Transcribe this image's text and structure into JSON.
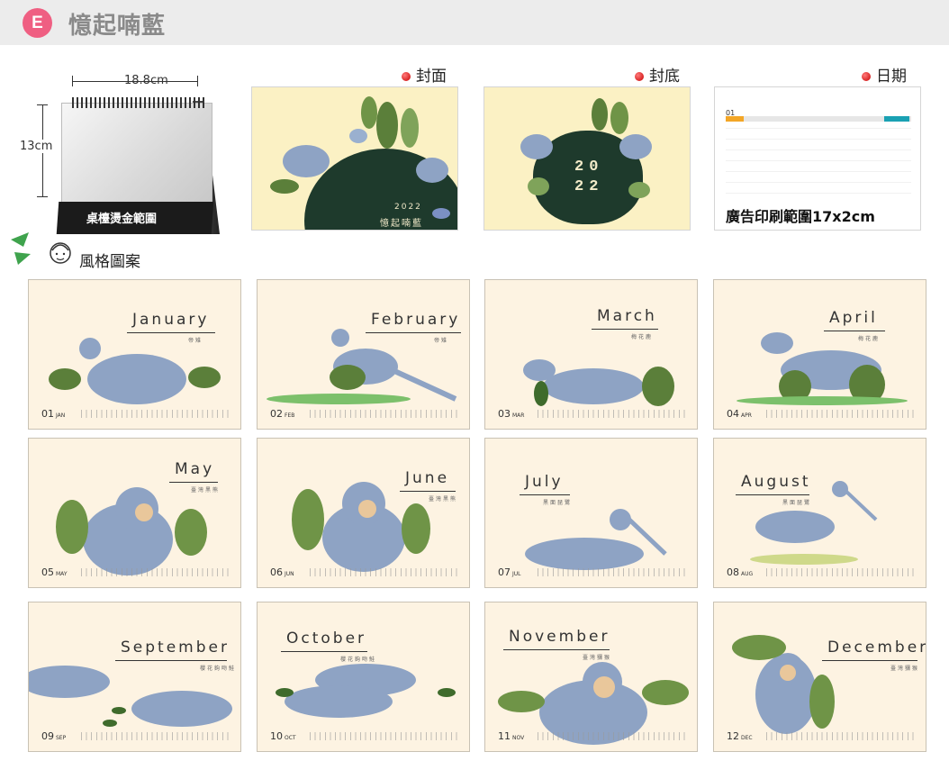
{
  "header": {
    "badge": "E",
    "title": "憶起喃藍"
  },
  "product": {
    "width_label": "18.8cm",
    "height_label": "13cm",
    "base_label": "桌檯燙金範圍"
  },
  "sections": {
    "cover": "封面",
    "back": "封底",
    "date": "日期"
  },
  "cover": {
    "year": "2022",
    "name": "憶起喃藍"
  },
  "back": {
    "year": "20 22"
  },
  "date_panel": {
    "month": "01",
    "ad_text": "廣告印刷範圍17x2cm"
  },
  "style_label": "風格圖案",
  "months": [
    {
      "name": "January",
      "sub": "帝雉",
      "num": "01",
      "abbr": "JAN"
    },
    {
      "name": "February",
      "sub": "帝雉",
      "num": "02",
      "abbr": "FEB"
    },
    {
      "name": "March",
      "sub": "梅花鹿",
      "num": "03",
      "abbr": "MAR"
    },
    {
      "name": "April",
      "sub": "梅花鹿",
      "num": "04",
      "abbr": "APR"
    },
    {
      "name": "May",
      "sub": "臺灣黑熊",
      "num": "05",
      "abbr": "MAY"
    },
    {
      "name": "June",
      "sub": "臺灣黑熊",
      "num": "06",
      "abbr": "JUN"
    },
    {
      "name": "July",
      "sub": "黑面琵鷺",
      "num": "07",
      "abbr": "JUL"
    },
    {
      "name": "August",
      "sub": "黑面琵鷺",
      "num": "08",
      "abbr": "AUG"
    },
    {
      "name": "September",
      "sub": "櫻花鉤吻鮭",
      "num": "09",
      "abbr": "SEP"
    },
    {
      "name": "October",
      "sub": "櫻花鉤吻鮭",
      "num": "10",
      "abbr": "OCT"
    },
    {
      "name": "November",
      "sub": "臺灣獼猴",
      "num": "11",
      "abbr": "NOV"
    },
    {
      "name": "December",
      "sub": "臺灣獼猴",
      "num": "12",
      "abbr": "DEC"
    }
  ],
  "colors": {
    "badge": "#ef5f82",
    "card_bg": "#fdf3e2",
    "cover_bg": "#fbf1c4",
    "hill": "#1e3a2c",
    "animal": "#8ea3c4",
    "leaf": "#5b7f3a"
  }
}
